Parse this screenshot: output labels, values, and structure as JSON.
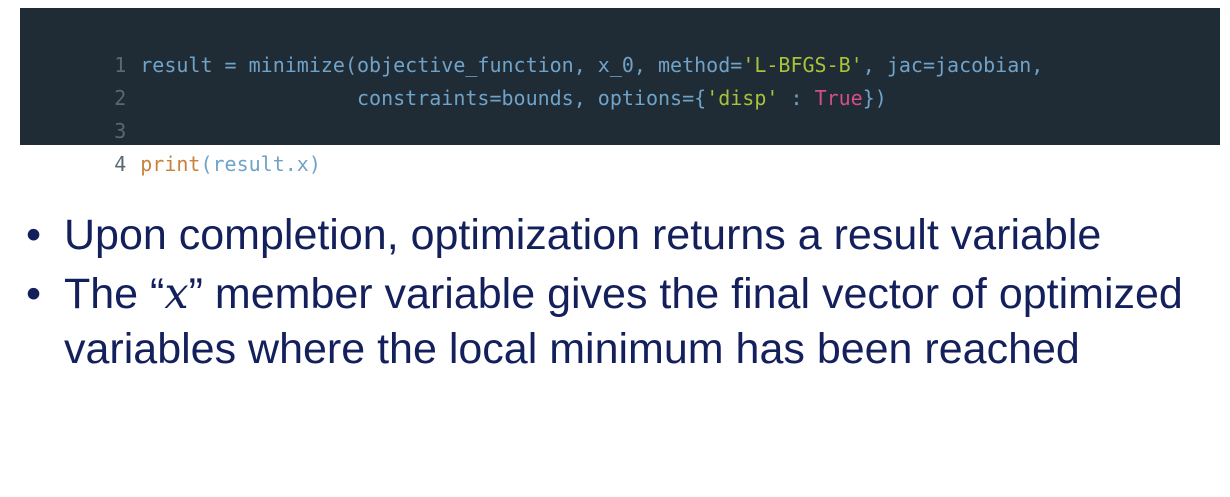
{
  "code": {
    "lines": [
      {
        "num": "1",
        "segments": [
          {
            "t": "result = minimize(objective_function, x_0, method=",
            "c": "plain"
          },
          {
            "t": "'L-BFGS-B'",
            "c": "str"
          },
          {
            "t": ", jac=jacobian,",
            "c": "plain"
          }
        ]
      },
      {
        "num": "2",
        "segments": [
          {
            "t": "                  constraints=bounds, options={",
            "c": "plain"
          },
          {
            "t": "'disp'",
            "c": "str"
          },
          {
            "t": " : ",
            "c": "plain"
          },
          {
            "t": "True",
            "c": "kw"
          },
          {
            "t": "})",
            "c": "plain"
          }
        ]
      },
      {
        "num": "3",
        "segments": []
      },
      {
        "num": "4",
        "segments": [
          {
            "t": "print",
            "c": "builtin"
          },
          {
            "t": "(result.x)",
            "c": "plain"
          }
        ]
      }
    ]
  },
  "bullets": {
    "marker": "•",
    "item1": "Upon completion, optimization returns a result variable",
    "item2_prefix": "The “",
    "item2_var": "x",
    "item2_suffix": "” member variable gives the final vector of optimized variables where the local minimum has been reached"
  },
  "colors": {
    "code_background": "#1f2b35",
    "bullet_text": "#14205c"
  }
}
